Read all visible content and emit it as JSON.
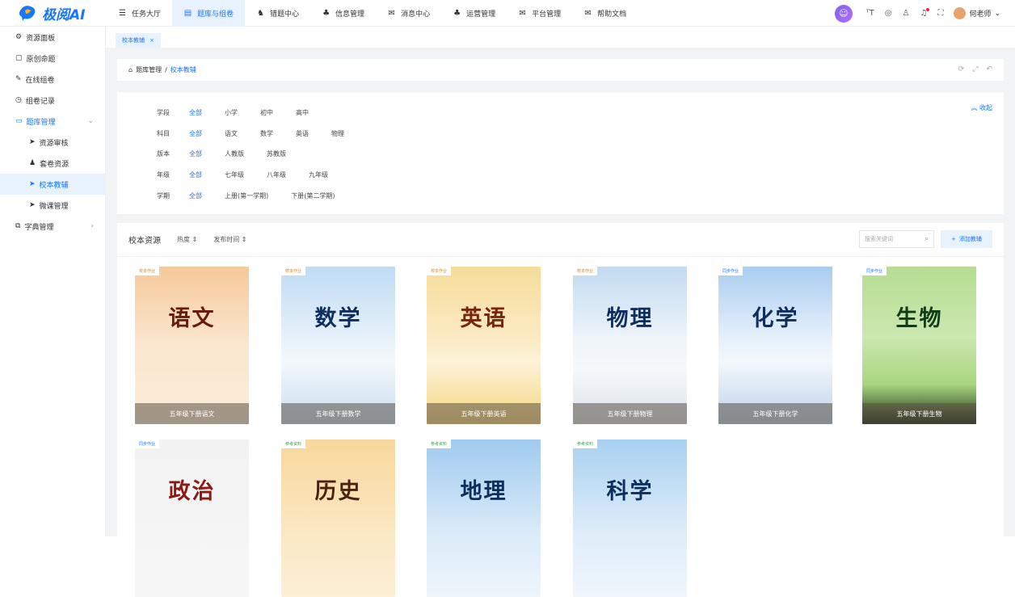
{
  "app": {
    "logo_text": "极阅AI",
    "user_name": "何老师"
  },
  "topnav": [
    {
      "label": "任务大厅",
      "icon": "menu-icon",
      "active": false
    },
    {
      "label": "题库与组卷",
      "icon": "book-icon",
      "active": true
    },
    {
      "label": "错题中心",
      "icon": "people-icon",
      "active": false
    },
    {
      "label": "信息管理",
      "icon": "org-icon",
      "active": false
    },
    {
      "label": "消息中心",
      "icon": "mail-icon",
      "active": false
    },
    {
      "label": "运营管理",
      "icon": "org-icon",
      "active": false
    },
    {
      "label": "平台管理",
      "icon": "mail-icon",
      "active": false
    },
    {
      "label": "帮助文档",
      "icon": "mail-icon",
      "active": false
    }
  ],
  "sidebar": {
    "items": [
      {
        "label": "资源面板",
        "icon": "gears-icon"
      },
      {
        "label": "原创命题",
        "icon": "doc-icon"
      },
      {
        "label": "在线组卷",
        "icon": "edit-icon"
      },
      {
        "label": "组卷记录",
        "icon": "clock-icon"
      },
      {
        "label": "题库管理",
        "icon": "folder-icon",
        "active_parent": true
      },
      {
        "label": "资源审核",
        "icon": "send-icon",
        "sub": true
      },
      {
        "label": "套卷资源",
        "icon": "group-icon",
        "sub": true
      },
      {
        "label": "校本教辅",
        "icon": "send-icon",
        "sub": true,
        "active": true
      },
      {
        "label": "微课管理",
        "icon": "send-icon",
        "sub": true
      },
      {
        "label": "字典管理",
        "icon": "dict-icon"
      }
    ]
  },
  "tabs": [
    {
      "label": "校本教辅",
      "close": "×"
    }
  ],
  "breadcrumb": {
    "root": "题库管理",
    "sep": "/",
    "current": "校本教辅"
  },
  "filters": {
    "collapse_label": "收起",
    "rows": [
      {
        "label": "学段",
        "options": [
          "全部",
          "小学",
          "初中",
          "高中"
        ]
      },
      {
        "label": "科目",
        "options": [
          "全部",
          "语文",
          "数学",
          "英语",
          "物理"
        ]
      },
      {
        "label": "版本",
        "options": [
          "全部",
          "人教版",
          "苏教版"
        ]
      },
      {
        "label": "年级",
        "options": [
          "全部",
          "七年级",
          "八年级",
          "九年级"
        ]
      },
      {
        "label": "学期",
        "options": [
          "全部",
          "上册(第一学期)",
          "下册(第二学期)"
        ]
      }
    ]
  },
  "resources": {
    "title": "校本资源",
    "sort1": "热度",
    "sort2": "发布时间",
    "search_placeholder": "搜索关键词",
    "add_label": "添加教辅",
    "books": [
      {
        "tag": "校本作业",
        "subject": "语文",
        "caption": "五年级下册语文",
        "color": "#6b1a12",
        "bg": "linear-gradient(180deg,#f6c99a 0%,#fbe7cf 50%,#fbecd9 100%)",
        "tagcolor": "#d4891f"
      },
      {
        "tag": "校本作业",
        "subject": "数学",
        "caption": "五年级下册数学",
        "color": "#0e2f5e",
        "bg": "linear-gradient(180deg,#bfdcf4 0%,#e7f1fa 45%,#f4f8fc 60%,#c9ddef 100%)",
        "tagcolor": "#d4891f"
      },
      {
        "tag": "校本作业",
        "subject": "英语",
        "caption": "五年级下册英语",
        "color": "#7a2410",
        "bg": "linear-gradient(180deg,#f6dc9a 0%,#fbeac2 45%,#fdf3da 60%,#f3d47e 100%)",
        "tagcolor": "#d4891f"
      },
      {
        "tag": "校本作业",
        "subject": "物理",
        "caption": "五年级下册物理",
        "color": "#0e2f5e",
        "bg": "linear-gradient(180deg,#c2daf0 0%,#eef4fa 45%,#f6f8fb 65%,#dbe3eb 100%)",
        "tagcolor": "#d4891f"
      },
      {
        "tag": "同步作业",
        "subject": "化学",
        "caption": "五年级下册化学",
        "color": "#0e2f5e",
        "bg": "linear-gradient(180deg,#a9cdf0 0%,#e6f0fa 45%,#f4f8fc 60%,#bcd3ea 100%)",
        "tagcolor": "#1677ff"
      },
      {
        "tag": "同步作业",
        "subject": "生物",
        "caption": "五年级下册生物",
        "color": "#0f3d1a",
        "bg": "linear-gradient(180deg,#b6dd92 0%,#cbe8b0 45%,#a8d57d 75%,#1b2a16 100%)",
        "tagcolor": "#1677ff"
      },
      {
        "tag": "同步作业",
        "subject": "政治",
        "caption": "",
        "color": "#8b1a14",
        "bg": "linear-gradient(180deg,#f2f2f2 0%,#f7f7f7 100%)",
        "tagcolor": "#1677ff"
      },
      {
        "tag": "参考资料",
        "subject": "历史",
        "caption": "",
        "color": "#4a2410",
        "bg": "linear-gradient(180deg,#f8d79c 0%,#fbe8c4 60%,#fcefd6 100%)",
        "tagcolor": "#2fa84f"
      },
      {
        "tag": "参考资料",
        "subject": "地理",
        "caption": "",
        "color": "#0e2f5e",
        "bg": "linear-gradient(180deg,#9fcbef 0%,#dcebf8 60%,#eef5fb 100%)",
        "tagcolor": "#2fa84f"
      },
      {
        "tag": "参考资料",
        "subject": "科学",
        "caption": "",
        "color": "#0e2f5e",
        "bg": "linear-gradient(180deg,#a7d1f1 0%,#dfedf9 60%,#f0f6fc 100%)",
        "tagcolor": "#2fa84f"
      }
    ]
  }
}
